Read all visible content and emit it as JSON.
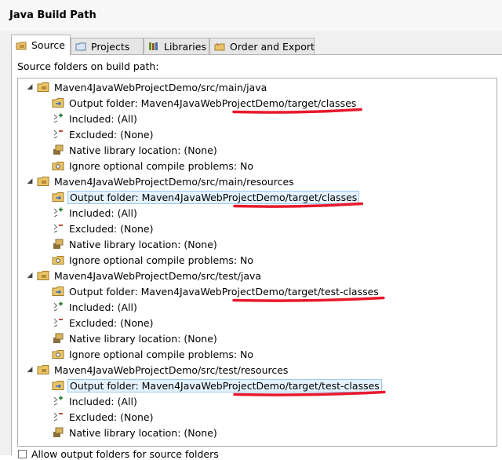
{
  "dialog": {
    "title": "Java Build Path"
  },
  "tabs": [
    {
      "label": "Source",
      "icon": "source-folder-icon",
      "active": true
    },
    {
      "label": "Projects",
      "icon": "projects-icon",
      "active": false
    },
    {
      "label": "Libraries",
      "icon": "libraries-icon",
      "active": false
    },
    {
      "label": "Order and Export",
      "icon": "order-export-icon",
      "active": false
    }
  ],
  "source": {
    "description": "Source folders on build path:",
    "folders": [
      {
        "path": "Maven4JavaWebProjectDemo/src/main/java",
        "output": "Output folder: Maven4JavaWebProjectDemo/target/classes",
        "output_selected": false,
        "included": "Included: (All)",
        "excluded": "Excluded: (None)",
        "native": "Native library location: (None)",
        "ignore": "Ignore optional compile problems: No"
      },
      {
        "path": "Maven4JavaWebProjectDemo/src/main/resources",
        "output": "Output folder: Maven4JavaWebProjectDemo/target/classes",
        "output_selected": true,
        "included": "Included: (All)",
        "excluded": "Excluded: (None)",
        "native": "Native library location: (None)",
        "ignore": "Ignore optional compile problems: No"
      },
      {
        "path": "Maven4JavaWebProjectDemo/src/test/java",
        "output": "Output folder: Maven4JavaWebProjectDemo/target/test-classes",
        "output_selected": false,
        "included": "Included: (All)",
        "excluded": "Excluded: (None)",
        "native": "Native library location: (None)",
        "ignore": "Ignore optional compile problems: No"
      },
      {
        "path": "Maven4JavaWebProjectDemo/src/test/resources",
        "output": "Output folder: Maven4JavaWebProjectDemo/target/test-classes",
        "output_selected": true,
        "included": "Included: (All)",
        "excluded": "Excluded: (None)",
        "native": "Native library location: (None)",
        "ignore": ""
      }
    ],
    "allow_output_checkbox": "Allow output folders for source folders",
    "allow_output_checked": false
  },
  "annotation_color": "#e8192c"
}
